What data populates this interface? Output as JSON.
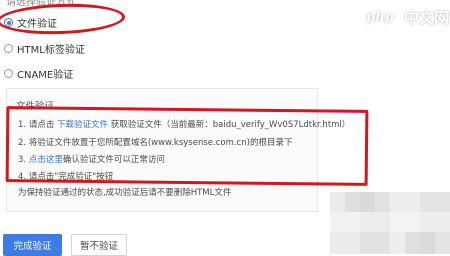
{
  "header": {
    "cut_label": "请选择验证方式："
  },
  "methods": [
    {
      "label": "文件验证",
      "selected": true
    },
    {
      "label": "HTML标签验证",
      "selected": false
    },
    {
      "label": "CNAME验证",
      "selected": false
    }
  ],
  "panel": {
    "title": "文件验证",
    "steps": [
      {
        "num": "1.",
        "prefix": "请点击 ",
        "link": "下载验证文件",
        "suffix": " 获取验证文件（当前最新：baidu_verify_Wv0S7Ldtkr.html）"
      },
      {
        "num": "2.",
        "text": "将验证文件放置于您所配置域名(www.ksysense.com.cn)的根目录下"
      },
      {
        "num": "3.",
        "link": "点击这里",
        "suffix": "确认验证文件可以正常访问"
      },
      {
        "num": "4.",
        "text": "请点击\"完成验证\"按钮"
      }
    ],
    "note": "为保持验证通过的状态,成功验证后请不要删除HTML文件"
  },
  "actions": {
    "complete": "完成验证",
    "skip": "暂不验证"
  },
  "watermark": {
    "logo_text": "php",
    "site_text": "中文网"
  },
  "colors": {
    "accent": "#3c7ce3",
    "annotation_red": "#d8141c"
  }
}
